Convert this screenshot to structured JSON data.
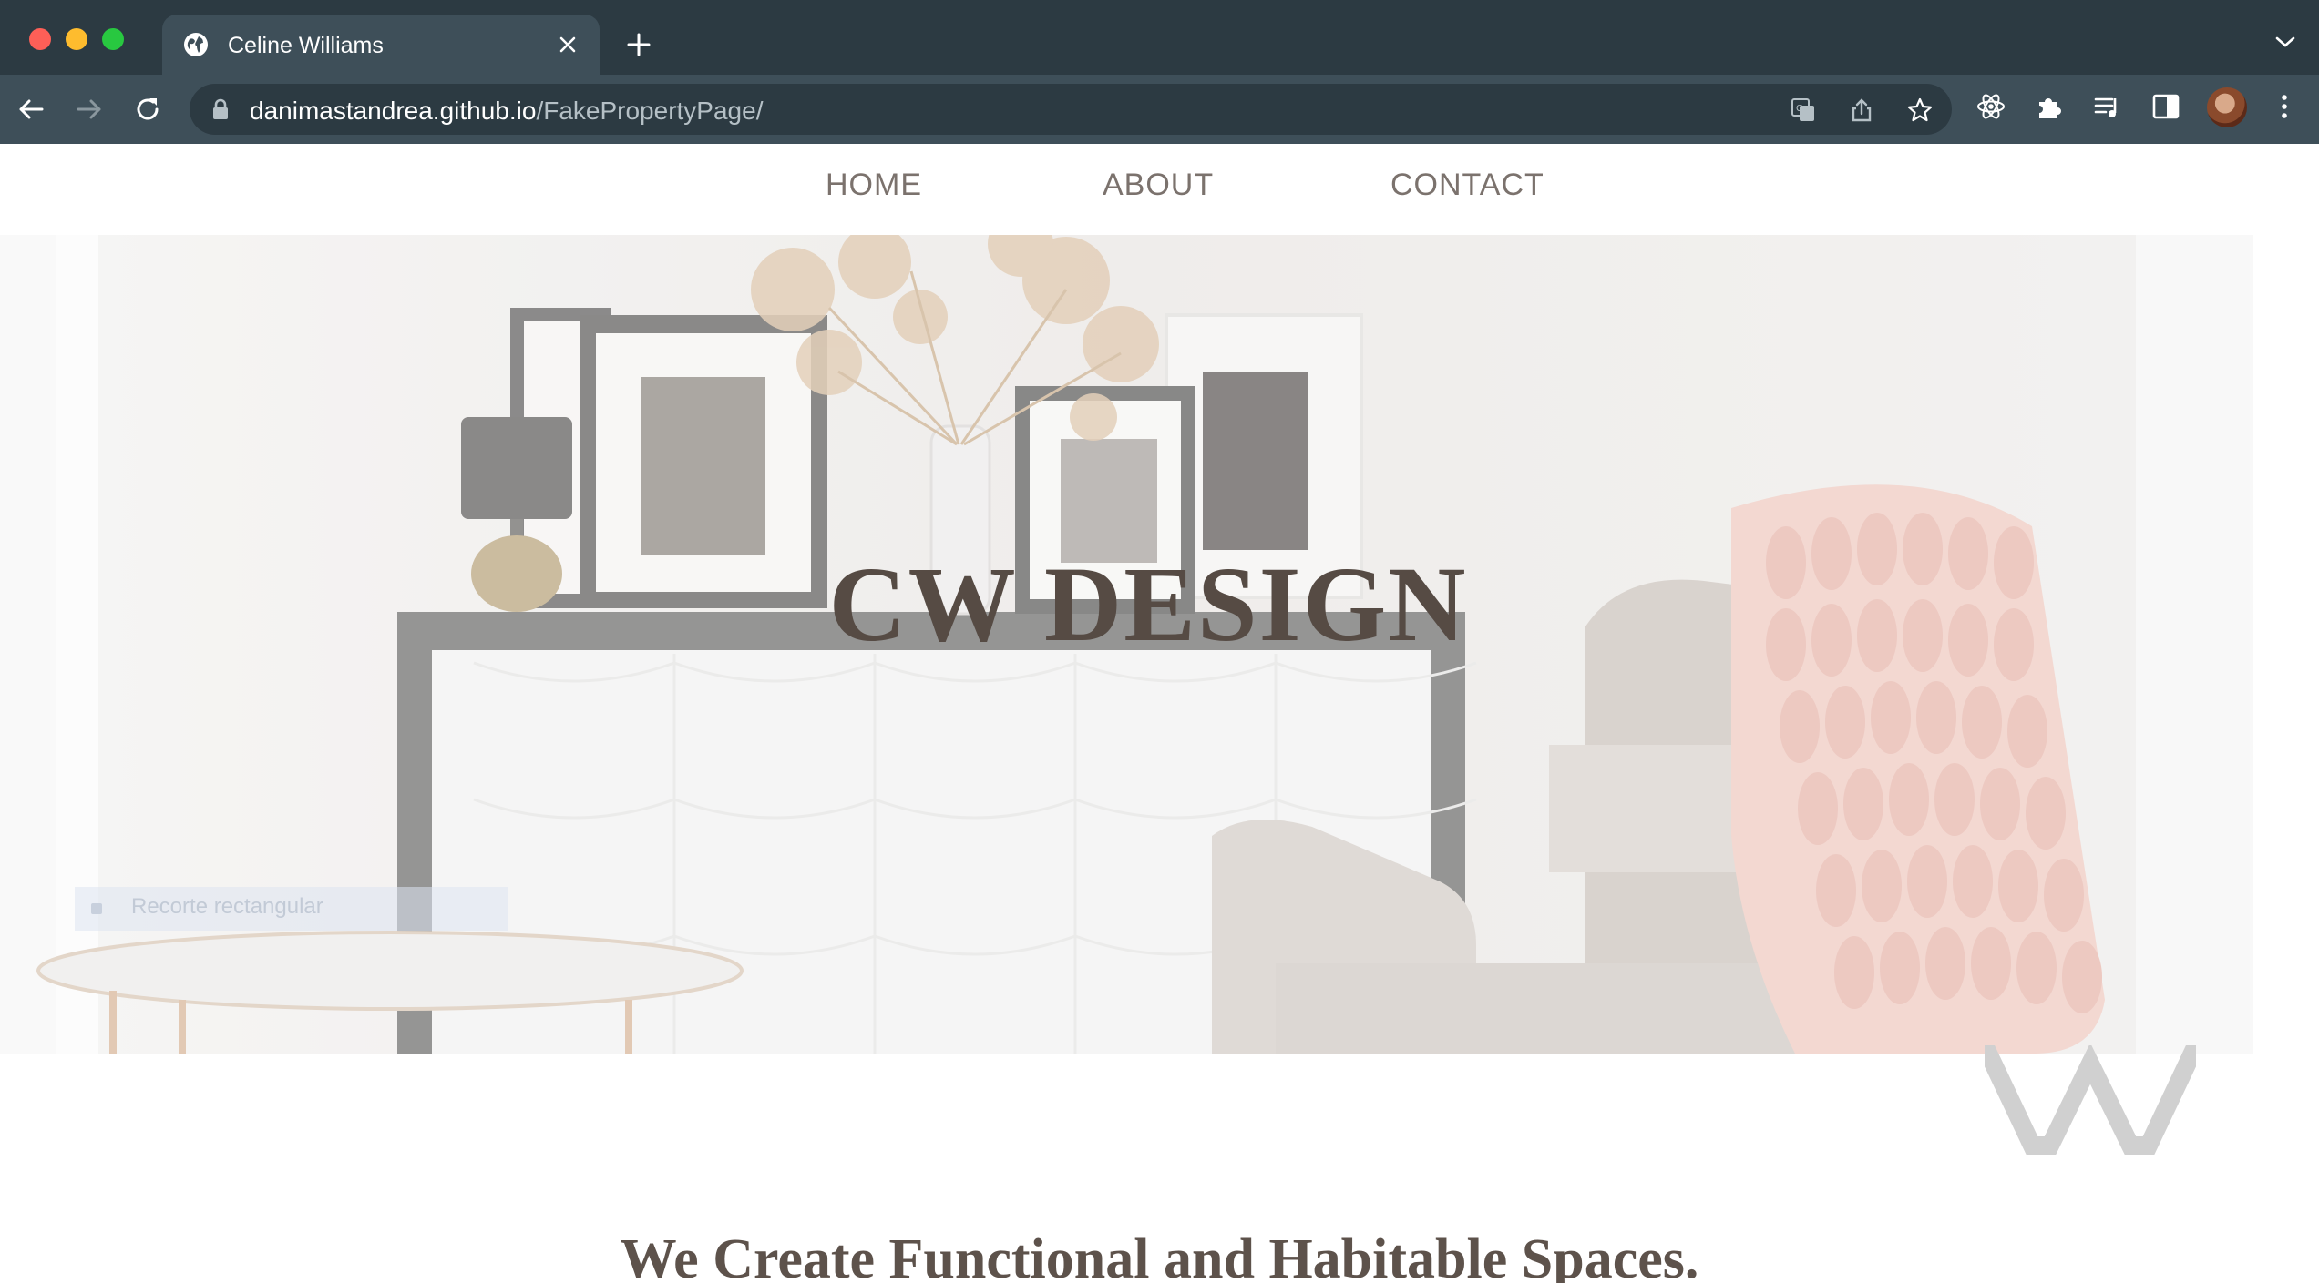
{
  "browser": {
    "tab": {
      "title": "Celine Williams"
    },
    "address": {
      "host": "danimastandrea.github.io",
      "path": "/FakePropertyPage/"
    }
  },
  "site": {
    "nav": [
      {
        "label": "HOME"
      },
      {
        "label": "ABOUT"
      },
      {
        "label": "CONTACT"
      }
    ],
    "hero": {
      "title": "CW DESIGN",
      "overlay_text": "Recorte rectangular"
    },
    "tagline": "We Create Functional and Habitable Spaces."
  },
  "colors": {
    "chrome_dark": "#2c3a42",
    "chrome_mid": "#3e4f59",
    "hero_text": "#564b44",
    "nav_text": "#7b726d"
  }
}
